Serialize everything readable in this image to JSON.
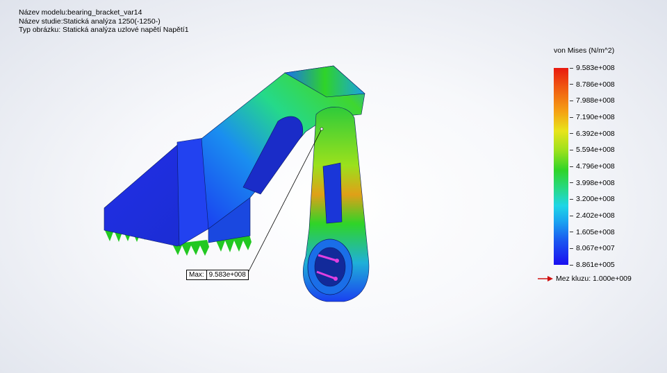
{
  "header": {
    "model_name": "Název modelu:bearing_bracket_var14",
    "study_name": "Název studie:Statická analýza 1250(-1250-)",
    "plot_type": "Typ obrázku: Statická analýza uzlové napětí Napětí1"
  },
  "legend": {
    "title": "von Mises (N/m^2)",
    "ticks": [
      "9.583e+008",
      "8.786e+008",
      "7.988e+008",
      "7.190e+008",
      "6.392e+008",
      "5.594e+008",
      "4.796e+008",
      "3.998e+008",
      "3.200e+008",
      "2.402e+008",
      "1.605e+008",
      "8.067e+007",
      "8.861e+005"
    ],
    "yield_label": "Mez kluzu: 1.000e+009",
    "colors": {
      "max": "#e81a10",
      "mid": "#2fd428",
      "min": "#1a0ff0"
    }
  },
  "probe": {
    "label": "Max:",
    "value": "9.583e+008"
  }
}
